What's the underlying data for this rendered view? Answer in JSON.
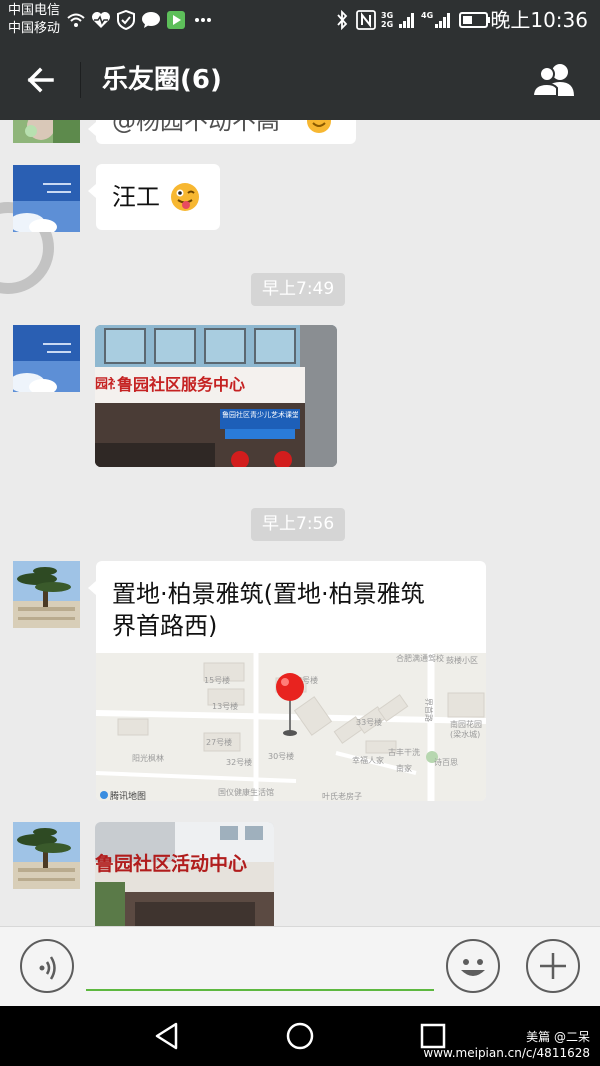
{
  "status_bar": {
    "carrier_1": "中国电信",
    "carrier_2": "中国移动",
    "network_label_1": "3G\n2G",
    "network_label_2": "4G",
    "clock": "晚上10:36",
    "icons": [
      "wifi-icon",
      "heart-pulse-icon",
      "app-shield-icon",
      "chat-bubble-icon",
      "video-icon",
      "more-dots-icon",
      "bluetooth-icon",
      "nfc-icon",
      "signal-icon",
      "battery-icon"
    ]
  },
  "header": {
    "title": "乐友圈(6)",
    "back_icon": "arrow-left-icon",
    "members_icon": "group-icon"
  },
  "messages": [
    {
      "type": "text",
      "partial_text": "@杨园不动不高",
      "emoji": "smile-emoji"
    },
    {
      "type": "text",
      "text": "汪工",
      "emoji": "wink-tongue-emoji"
    },
    {
      "type": "time",
      "text": "早上7:49"
    },
    {
      "type": "image",
      "sign_text": "鲁园社区服务中心",
      "sub_sign_text": "鲁园社区青少儿艺术课堂",
      "left_sign_text": "园社区"
    },
    {
      "type": "time",
      "text": "早上7:56"
    },
    {
      "type": "location",
      "title": "置地·柏景雅筑(置地·柏景雅筑",
      "subtitle": "界首路西)",
      "map_labels": [
        "合肥满通驾校",
        "鼓楼小区",
        "界首路",
        "南园花园",
        "(梁水城)",
        "阳光枫林",
        "13号楼",
        "15号楼",
        "33号楼",
        "27号楼",
        "33号楼",
        "30号楼",
        "32号楼",
        "幸福人家",
        "古丰干洗",
        "诗百思",
        "南家",
        "国仪健康生活馆",
        "叶氏老房子",
        "腾讯地图"
      ]
    },
    {
      "type": "image",
      "sign_text": "鲁园社区活动中心"
    }
  ],
  "input_bar": {
    "voice_icon": "voice-icon",
    "emoji_icon": "smiley-icon",
    "plus_icon": "plus-icon",
    "input_value": ""
  },
  "nav_bar": {
    "icons": [
      "back-triangle-icon",
      "home-circle-icon",
      "recents-square-icon"
    ],
    "watermark_1": "美篇 @二呆",
    "watermark_2": "www.meipian.cn/c/4811628"
  }
}
